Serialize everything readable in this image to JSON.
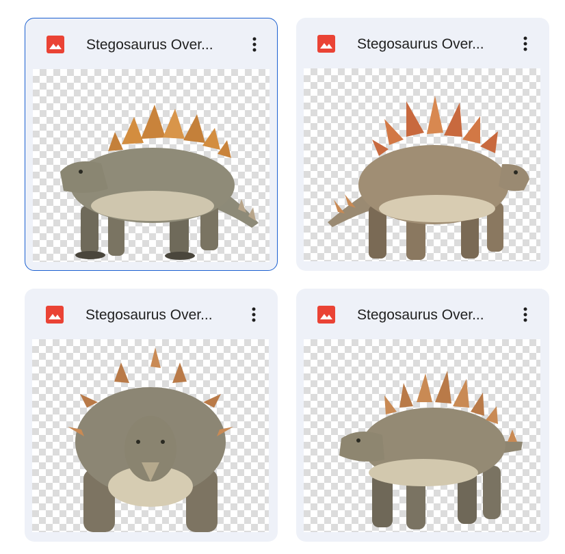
{
  "files": [
    {
      "title": "Stegosaurus Over...",
      "icon": "image-file-icon",
      "selected": true,
      "view": "left-profile"
    },
    {
      "title": "Stegosaurus Over...",
      "icon": "image-file-icon",
      "selected": false,
      "view": "right-profile"
    },
    {
      "title": "Stegosaurus Over...",
      "icon": "image-file-icon",
      "selected": false,
      "view": "front"
    },
    {
      "title": "Stegosaurus Over...",
      "icon": "image-file-icon",
      "selected": false,
      "view": "left-three-quarter"
    }
  ],
  "colors": {
    "card_background": "#eef1f8",
    "selected_border": "#1a5fd0",
    "image_icon": "#ea4335",
    "title_text": "#1f1f1f"
  }
}
